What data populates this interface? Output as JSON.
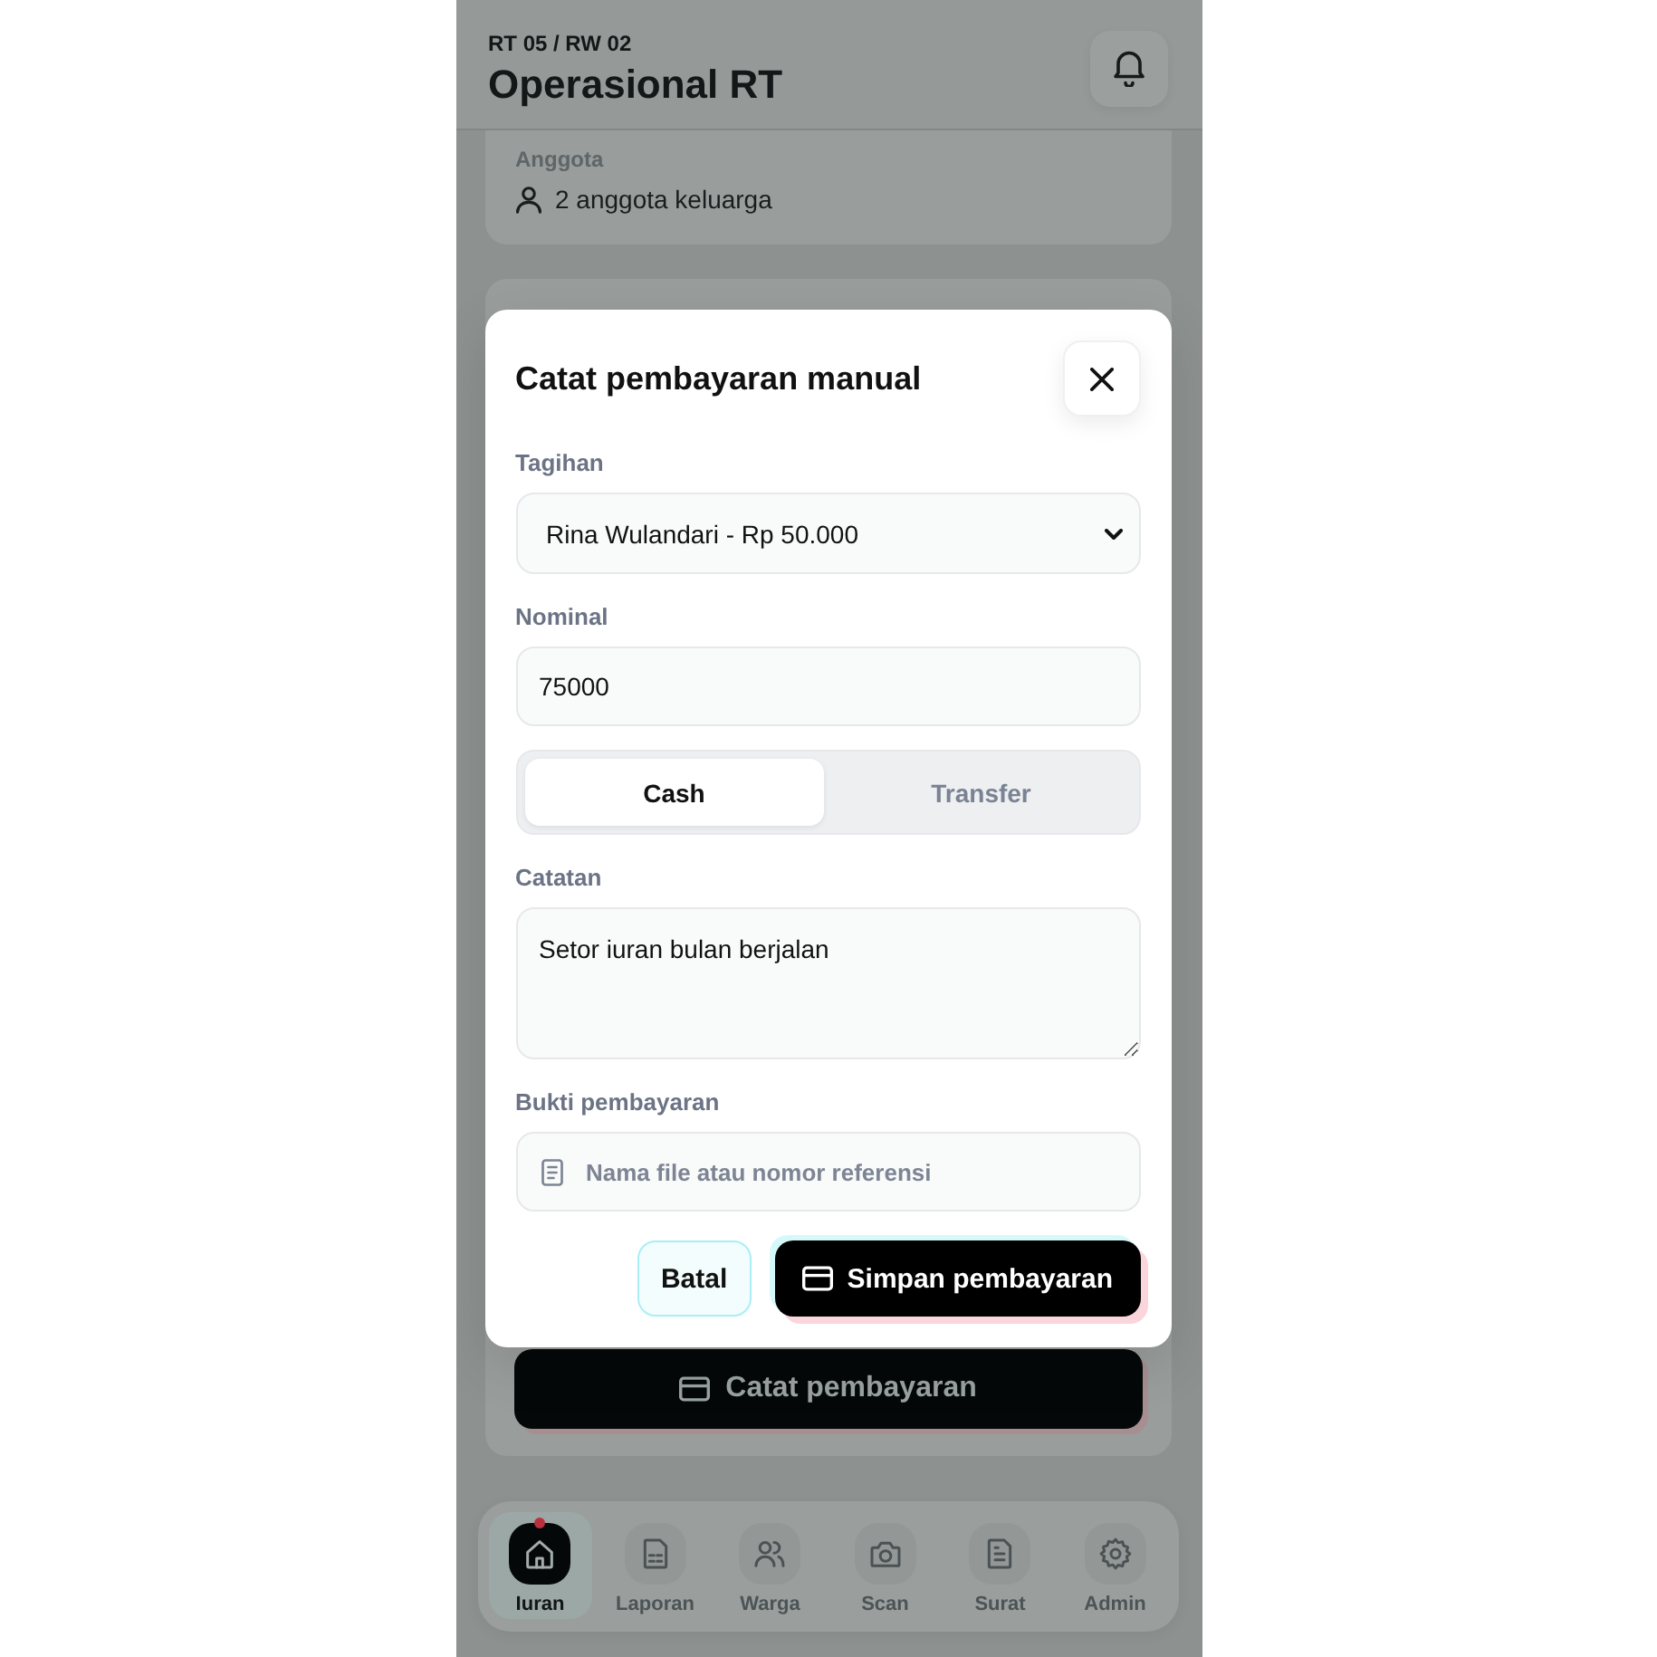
{
  "header": {
    "subtitle": "RT 05 / RW 02",
    "title": "Operasional RT"
  },
  "member_card": {
    "label": "Anggota",
    "value": "2 anggota keluarga"
  },
  "payment_card": {
    "button": "Catat pembayaran"
  },
  "dialog": {
    "title": "Catat pembayaran manual",
    "fields": [
      {
        "kind": "select",
        "label": "Tagihan",
        "value": "Rina Wulandari - Rp 50.000"
      },
      {
        "kind": "input",
        "label": "Nominal",
        "value": "75000"
      },
      {
        "kind": "segmented",
        "options": [
          {
            "label": "Cash",
            "selected": true
          },
          {
            "label": "Transfer",
            "selected": false
          }
        ]
      },
      {
        "kind": "textarea",
        "label": "Catatan",
        "value": "Setor iuran bulan berjalan"
      },
      {
        "kind": "file",
        "label": "Bukti pembayaran",
        "placeholder": "Nama file atau nomor referensi"
      }
    ],
    "buttons": [
      {
        "kind": "secondary",
        "label": "Batal"
      },
      {
        "kind": "primary",
        "label": "Simpan pembayaran"
      }
    ]
  },
  "bottom_nav": [
    {
      "label": "Iuran",
      "selected": true,
      "dot": true
    },
    {
      "label": "Laporan",
      "selected": false,
      "dot": false
    },
    {
      "label": "Warga",
      "selected": false,
      "dot": false
    },
    {
      "label": "Scan",
      "selected": false,
      "dot": false
    },
    {
      "label": "Surat",
      "selected": false,
      "dot": false
    },
    {
      "label": "Admin",
      "selected": false,
      "dot": false
    }
  ]
}
